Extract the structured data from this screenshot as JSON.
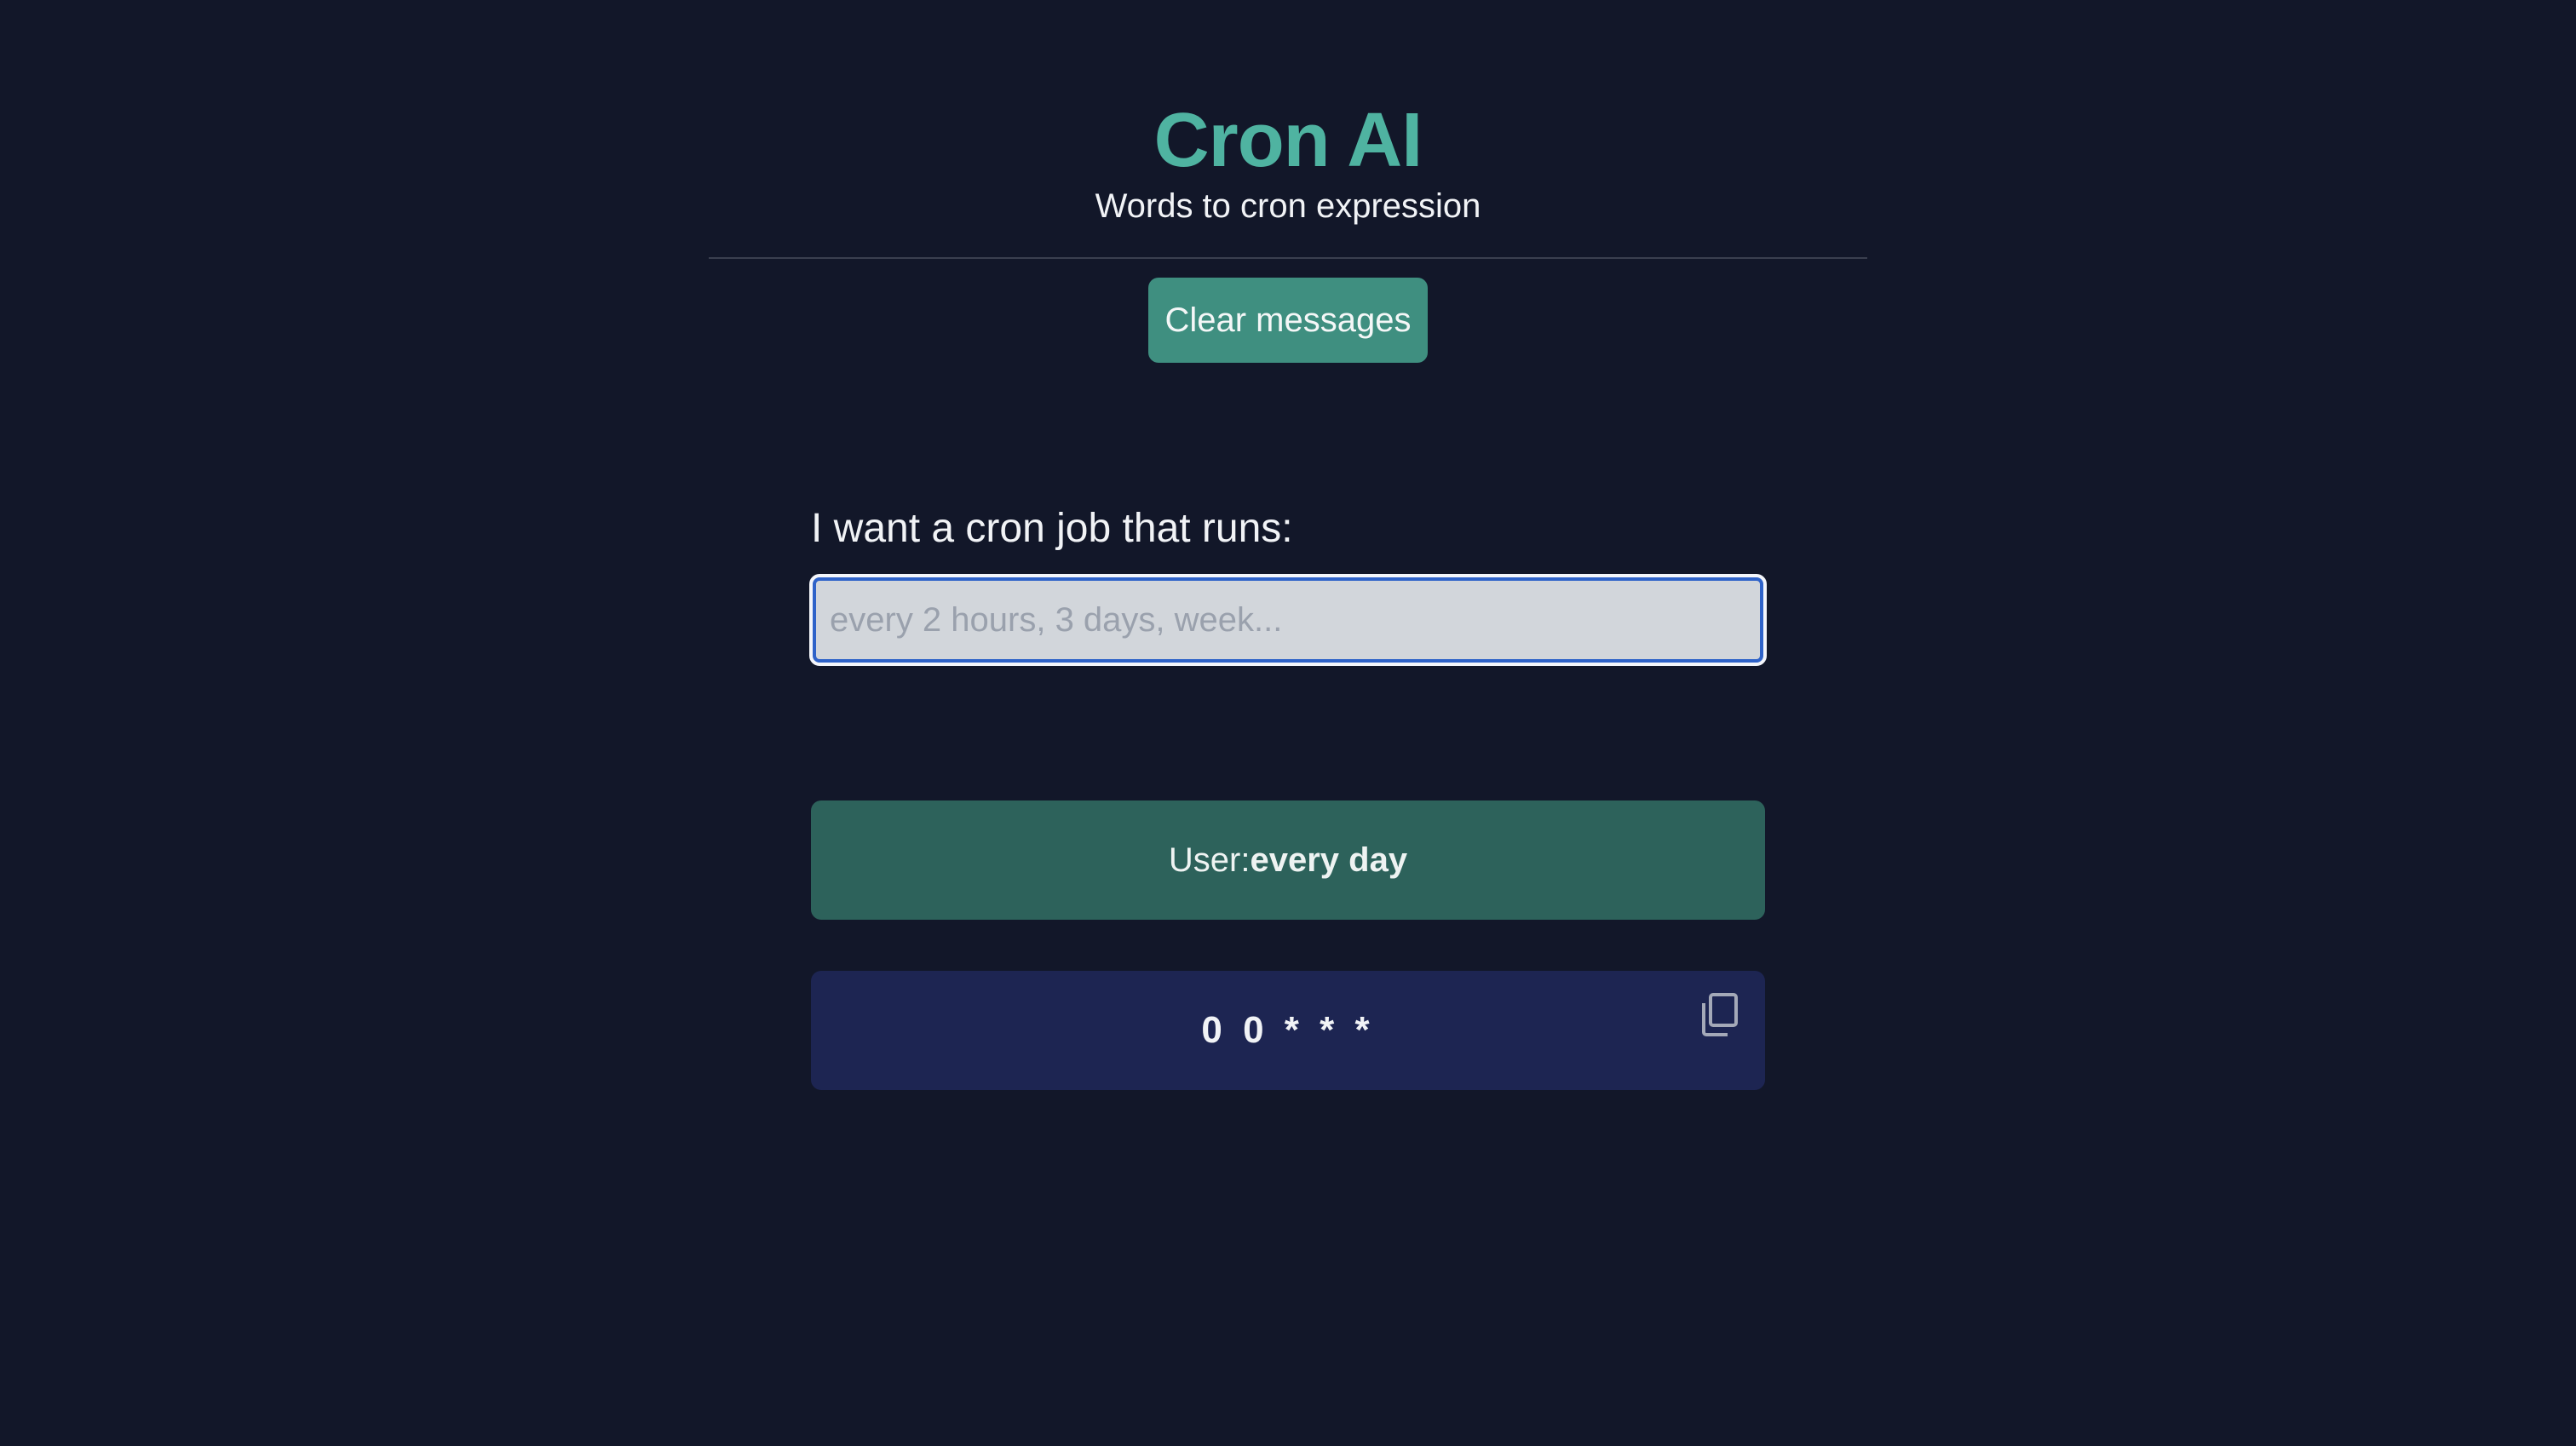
{
  "header": {
    "title": "Cron AI",
    "subtitle": "Words to cron expression"
  },
  "actions": {
    "clear_label": "Clear messages"
  },
  "prompt": {
    "label": "I want a cron job that runs:",
    "value": "",
    "placeholder": "every 2 hours, 3 days, week..."
  },
  "messages": [
    {
      "role": "user",
      "prefix": "User:",
      "text": "every day"
    },
    {
      "role": "result",
      "cron": "0 0 * * *",
      "icon": "copy-icon"
    }
  ],
  "colors": {
    "background": "#121729",
    "accent": "#4fb3a1",
    "button": "#3f8f80",
    "user_bubble": "#2d625b",
    "result_bubble": "#1d2552",
    "input_focus": "#2f63c9"
  }
}
